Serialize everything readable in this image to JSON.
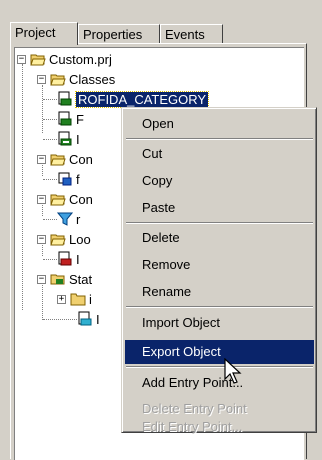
{
  "tabs": {
    "project": "Project",
    "properties": "Properties",
    "events": "Events"
  },
  "tree": {
    "root": "Custom.prj",
    "classes": "Classes",
    "class_selected": "ROFIDA_CATEGORY",
    "class_2": "F",
    "class_3": "I",
    "con_1": "Con",
    "con_1_child": "f",
    "con_2": "Con",
    "con_2_child": "r",
    "loo": "Loo",
    "loo_child": "I",
    "stat": "Stat",
    "stat_child_1": "i",
    "stat_child_2": "I"
  },
  "context_menu": {
    "open": "Open",
    "cut": "Cut",
    "copy": "Copy",
    "paste": "Paste",
    "delete": "Delete",
    "remove": "Remove",
    "rename": "Rename",
    "import_object": "Import Object",
    "export_object": "Export Object",
    "add_entry_point": "Add Entry Point...",
    "delete_entry_point": "Delete Entry Point",
    "edit_entry_point": "Edit Entry Point..."
  },
  "colors": {
    "selection": "#0a246a",
    "window_bg": "#d4d0c8",
    "folder": "#f0d070",
    "disabled_text": "#a0a0a0"
  }
}
